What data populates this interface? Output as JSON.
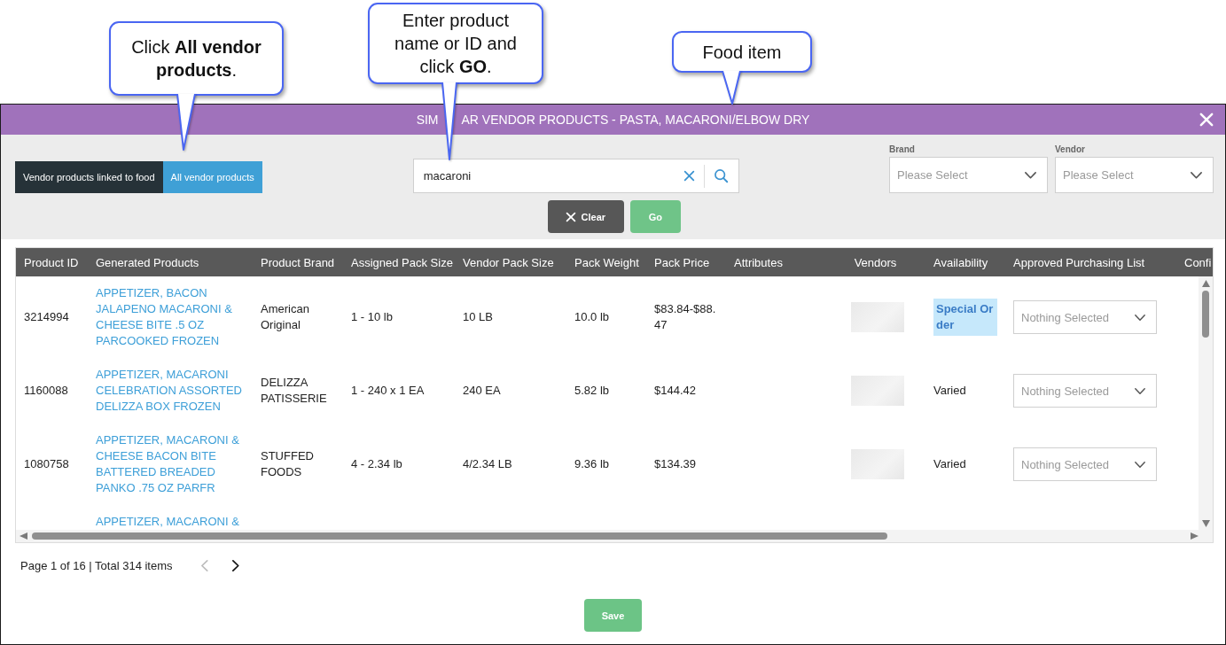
{
  "callouts": [
    {
      "text": "Click **All vendor products**."
    },
    {
      "text": "Enter product name or ID and click **GO**."
    },
    {
      "text": "Food item"
    }
  ],
  "dialog": {
    "title_parts": [
      "SIM",
      "AR VENDOR PRODUCTS - PASTA, MACARONI/ELBOW DRY"
    ]
  },
  "tabs": [
    {
      "label": "Vendor products linked to food",
      "selected": false
    },
    {
      "label": "All vendor products",
      "selected": true
    }
  ],
  "search": {
    "value": "macaroni"
  },
  "actions": [
    {
      "label": "Clear",
      "kind": "clear"
    },
    {
      "label": "Go",
      "kind": "go"
    }
  ],
  "filters": [
    {
      "label": "Brand",
      "placeholder": "Please Select"
    },
    {
      "label": "Vendor",
      "placeholder": "Please Select"
    }
  ],
  "table": {
    "columns": [
      "Product ID",
      "Generated Products",
      "Product Brand",
      "Assigned Pack Size",
      "Vendor Pack Size",
      "Pack Weight",
      "Pack Price",
      "Attributes",
      "Vendors",
      "Availability",
      "Approved Purchasing List",
      "Confi"
    ],
    "rows": [
      {
        "product_id": "3214994",
        "generated_product": "APPETIZER, BACON JALAPENO MACARONI & CHEESE BITE .5 OZ PARCOOKED FROZEN",
        "product_brand": "American Original",
        "assigned_pack_size": "1 - 10 lb",
        "vendor_pack_size": "10 LB",
        "pack_weight": "10.0 lb",
        "pack_price": "$83.84-$88.47",
        "vendor_image": true,
        "availability": "Special Order",
        "highlighted": true,
        "approved_purchasing_list": {
          "placeholder": "Nothing Selected"
        }
      },
      {
        "product_id": "1160088",
        "generated_product": "APPETIZER, MACARONI CELEBRATION ASSORTED DELIZZA BOX FROZEN",
        "product_brand": "DELIZZA PATISSERIE",
        "assigned_pack_size": "1 - 240 x 1 EA",
        "vendor_pack_size": "240 EA",
        "pack_weight": "5.82 lb",
        "pack_price": "$144.42",
        "vendor_image": true,
        "availability": "Varied",
        "highlighted": false,
        "approved_purchasing_list": {
          "placeholder": "Nothing Selected"
        }
      },
      {
        "product_id": "1080758",
        "generated_product": "APPETIZER, MACARONI & CHEESE BACON BITE BATTERED BREADED PANKO .75 OZ PARFR",
        "product_brand": "STUFFED FOODS",
        "assigned_pack_size": "4 - 2.34 lb",
        "vendor_pack_size": "4/2.34 LB",
        "pack_weight": "9.36 lb",
        "pack_price": "$134.39",
        "vendor_image": true,
        "availability": "Varied",
        "highlighted": false,
        "approved_purchasing_list": {
          "placeholder": "Nothing Selected"
        }
      },
      {
        "generated_product": "APPETIZER, MACARONI &"
      }
    ]
  },
  "pagination": {
    "summary": "Page 1 of 16 | Total 314 items",
    "prev_disabled": true,
    "next_disabled": false
  },
  "save_button": {
    "label": "Save"
  }
}
